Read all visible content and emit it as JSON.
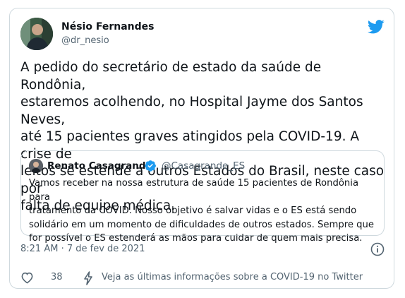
{
  "tweet": {
    "author": {
      "name": "Nésio Fernandes",
      "handle": "@dr_nesio"
    },
    "text": "A pedido do secretário de estado da saúde de Rondônia,\nestaremos acolhendo, no Hospital Jayme dos Santos Neves,\naté 15 pacientes graves atingidos pela COVID-19. A crise de\nleitos se estende a outros Estados do Brasil, neste caso por\nfalta de equipe médica.",
    "timestamp": "8:21 AM · 7 de fev de 2021"
  },
  "quote": {
    "author": {
      "name": "Renato Casagrande",
      "handle": "@Casagrande_ES",
      "verified": true
    },
    "text": "Vamos receber na nossa estrutura de saúde 15 pacientes de Rondônia para\ntratamento da COVID. Nosso objetivo é salvar vidas e o ES está sendo\nsolidário em um momento de dificuldades de outros estados. Sempre que\nfor possível o ES estenderá as mãos para cuidar de quem mais precisa."
  },
  "footer": {
    "likes": "38",
    "covid_info": "Veja as últimas informações sobre a COVID-19 no Twitter"
  },
  "icons": {
    "logo": "twitter-bird-icon",
    "verified": "verified-badge-icon",
    "info": "info-icon",
    "like": "heart-icon",
    "covid": "lightning-bolt-icon"
  },
  "colors": {
    "twitter_blue": "#1d9bf0",
    "text_primary": "#0f1419",
    "text_secondary": "#536471",
    "border": "#cfd9de"
  }
}
